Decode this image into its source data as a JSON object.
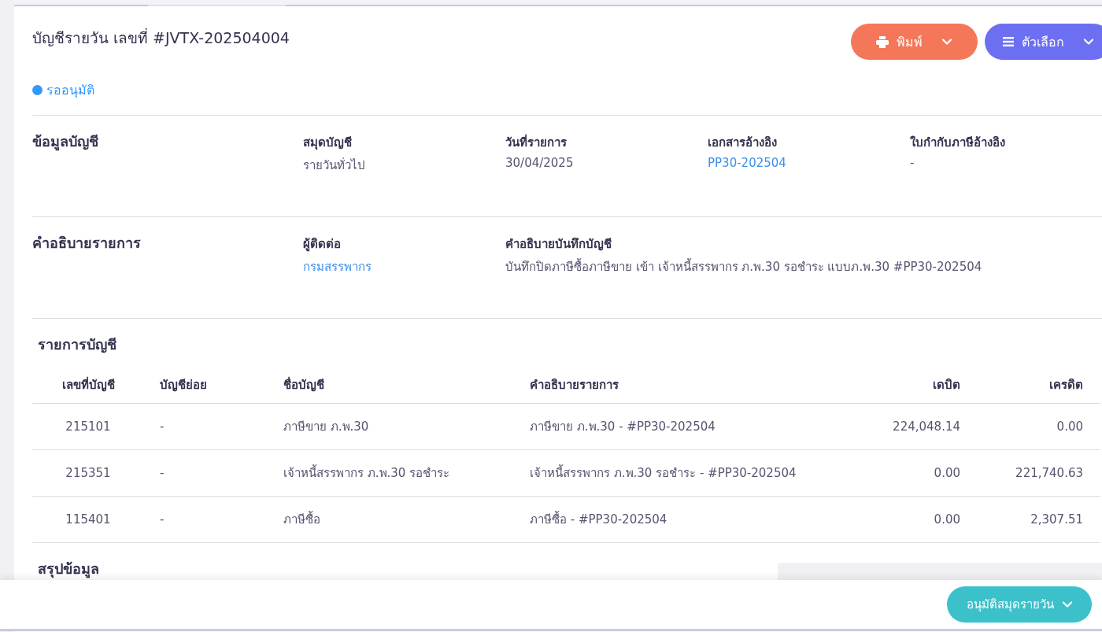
{
  "title": "บัญชีรายวัน เลขที่ #JVTX-202504004",
  "actions": [
    {
      "kind": "print",
      "label": "พิมพ์",
      "color": "#f4775a"
    },
    {
      "kind": "menu",
      "label": "ตัวเลือก",
      "color": "#6c6ff2"
    }
  ],
  "status": {
    "label": "รออนุมัติ",
    "color": "#3399ff"
  },
  "sections": [
    {
      "heading": "ข้อมูลบัญชี",
      "fields": [
        {
          "label": "สมุดบัญชี",
          "value": "รายวันทั่วไป",
          "kind": "text"
        },
        {
          "label": "วันที่รายการ",
          "value": "30/04/2025",
          "kind": "text"
        },
        {
          "label": "เอกสารอ้างอิง",
          "value": "PP30-202504",
          "kind": "link"
        },
        {
          "label": "ใบกำกับภาษีอ้างอิง",
          "value": "-",
          "kind": "text"
        }
      ]
    },
    {
      "heading": "คำอธิบายรายการ",
      "fields": [
        {
          "label": "ผู้ติดต่อ",
          "value": "กรมสรรพากร",
          "kind": "link"
        },
        {
          "label": "คำอธิบายบันทึกบัญชี",
          "value": "บันทึกปิดภาษีซื้อภาษีขาย เข้า เจ้าหนี้สรรพากร ภ.พ.30 รอชำระ แบบภ.พ.30 #PP30-202504",
          "kind": "wide"
        }
      ]
    }
  ],
  "entries": {
    "heading": "รายการบัญชี",
    "columns": [
      "เลขที่บัญชี",
      "บัญชีย่อย",
      "ชื่อบัญชี",
      "คำอธิบายรายการ",
      "เดบิต",
      "เครดิต"
    ],
    "rows": [
      [
        "215101",
        "-",
        "ภาษีขาย ภ.พ.30",
        "ภาษีขาย ภ.พ.30 - #PP30-202504",
        "224,048.14",
        "0.00"
      ],
      [
        "215351",
        "-",
        "เจ้าหนี้สรรพากร ภ.พ.30 รอชำระ",
        "เจ้าหนี้สรรพากร ภ.พ.30 รอชำระ - #PP30-202504",
        "0.00",
        "221,740.63"
      ],
      [
        "115401",
        "-",
        "ภาษีซื้อ",
        "ภาษีซื้อ - #PP30-202504",
        "0.00",
        "2,307.51"
      ]
    ]
  },
  "summary": {
    "heading": "สรุปข้อมูล"
  },
  "footer": {
    "button": "อนุมัติสมุดรายวัน"
  }
}
